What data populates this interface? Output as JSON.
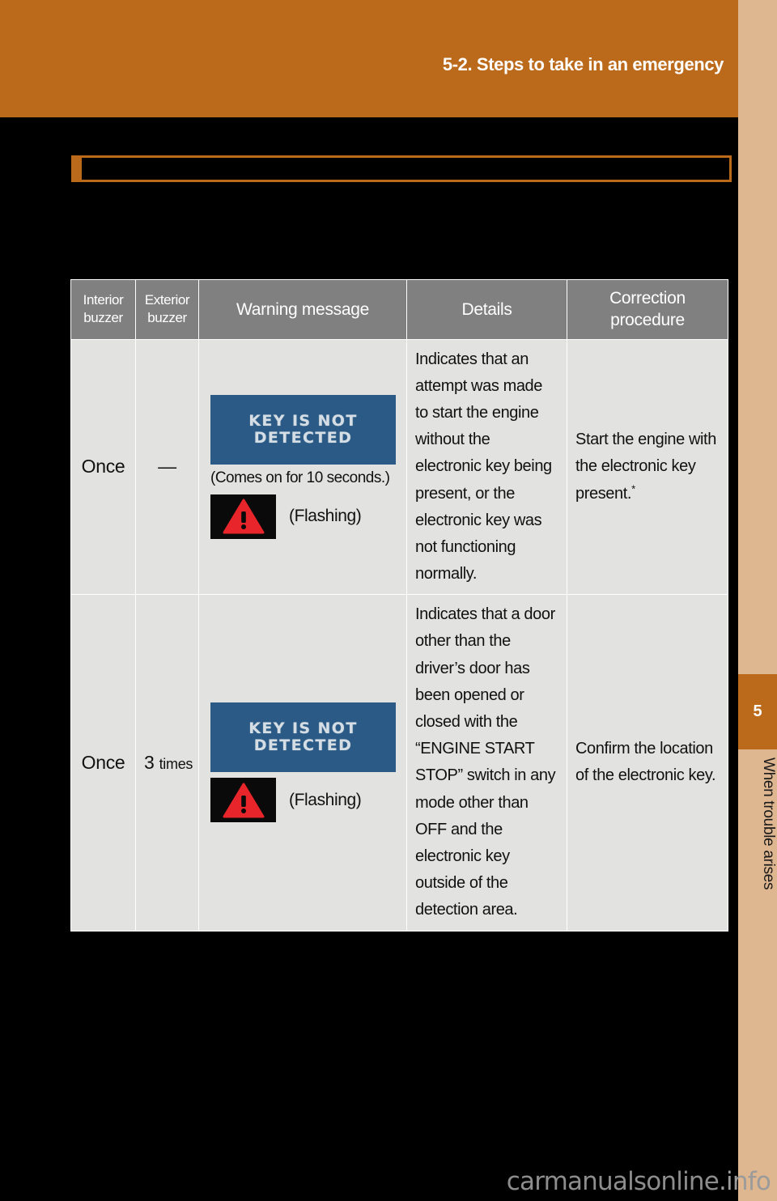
{
  "header": {
    "title": "5-2. Steps to take in an emergency"
  },
  "section_box": {
    "text": ""
  },
  "sidebar": {
    "chapter_number": "5",
    "chapter_label": "When trouble arises"
  },
  "table": {
    "columns": [
      {
        "label_line1": "Interior",
        "label_line2": "buzzer"
      },
      {
        "label_line1": "Exterior",
        "label_line2": "buzzer"
      },
      {
        "label_line1": "Warning message",
        "label_line2": ""
      },
      {
        "label_line1": "Details",
        "label_line2": ""
      },
      {
        "label_line1": "Correction",
        "label_line2": "procedure"
      }
    ],
    "rows": [
      {
        "interior_buzzer": "Once",
        "exterior_buzzer": "—",
        "message": {
          "display_line1": "KEY IS NOT",
          "display_line2": "DETECTED",
          "caption": "(Comes on for 10 seconds.)",
          "icon_name": "warning-triangle-icon",
          "icon_label": "(Flashing)"
        },
        "details": "Indicates that an attempt was made to start the engine without the electronic key being present, or the electronic key was not functioning normally.",
        "correction": "Start the engine with the electronic key present.",
        "correction_footnote_marker": "*"
      },
      {
        "interior_buzzer": "Once",
        "exterior_buzzer_number": "3",
        "exterior_buzzer_unit": "times",
        "message": {
          "display_line1": "KEY IS NOT",
          "display_line2": "DETECTED",
          "caption": "",
          "icon_name": "warning-triangle-icon",
          "icon_label": "(Flashing)"
        },
        "details": "Indicates that a door other than the driver’s door has been opened or closed with the “ENGINE START STOP” switch in any mode other than OFF and the electronic key outside of the detection area.",
        "correction": "Confirm the location of the electronic key.",
        "correction_footnote_marker": ""
      }
    ]
  },
  "watermark": {
    "text_main": "carmanualsonline",
    "text_suffix": ".info"
  },
  "colors": {
    "header_orange": "#bb6a1b",
    "sidebar_tan": "#deb68f",
    "table_header_gray": "#808080",
    "table_cell_gray": "#e2e2e1",
    "lcd_blue": "#2a5a85",
    "warning_red": "#e8252a",
    "page_black": "#000000"
  }
}
